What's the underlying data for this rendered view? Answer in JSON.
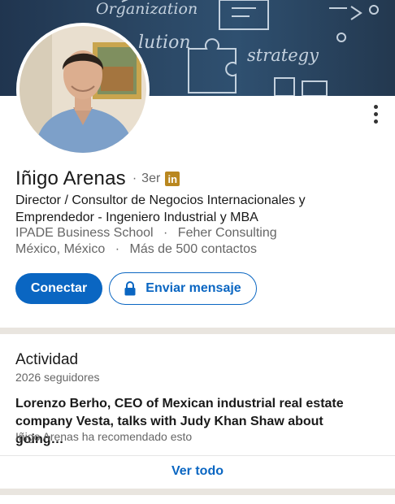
{
  "banner": {
    "words": [
      "Organization",
      "lution",
      "strategy"
    ]
  },
  "profile": {
    "name": "Iñigo Arenas",
    "dot": "·",
    "degree": "3er",
    "badge": "in",
    "headline_line1": "Director / Consultor de Negocios Internacionales y",
    "headline_line2": "Emprendedor - Ingeniero Industrial y MBA",
    "education": "IPADE Business School",
    "company": "Feher Consulting",
    "location": "México, México",
    "connections": "Más de 500 contactos",
    "separator": "·"
  },
  "actions": {
    "connect_label": "Conectar",
    "message_label": "Enviar mensaje"
  },
  "activity": {
    "title": "Actividad",
    "followers": "2026 seguidores",
    "post_title_line1": "Lorenzo Berho, CEO of Mexican industrial real estate",
    "post_title_line2": "company Vesta, talks with Judy Khan Shaw about going…",
    "post_meta": "Iñigo Arenas ha recomendado esto",
    "see_all": "Ver todo"
  },
  "colors": {
    "primary": "#0a66c2",
    "badge": "#b9871f",
    "divider": "#e9e5df"
  }
}
